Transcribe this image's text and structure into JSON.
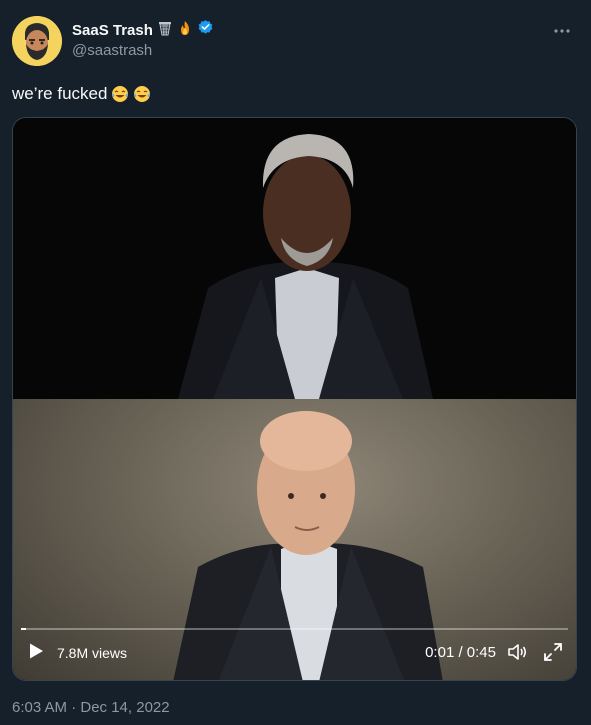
{
  "user": {
    "display_name": "SaaS Trash",
    "badge_emojis": [
      "basket-icon",
      "fire-icon"
    ],
    "verified": true,
    "handle": "@saastrash"
  },
  "tweet": {
    "text": "we’re fucked",
    "emojis": [
      "tears-of-joy-icon",
      "tears-of-joy-icon"
    ]
  },
  "video": {
    "views": "7.8M views",
    "time": "0:01 / 0:45",
    "progress": 0.01
  },
  "timestamp": "6:03 AM · Dec 14, 2022",
  "colors": {
    "background": "#15202b",
    "verified": "#1d9bf0",
    "muted": "#8b98a5"
  }
}
